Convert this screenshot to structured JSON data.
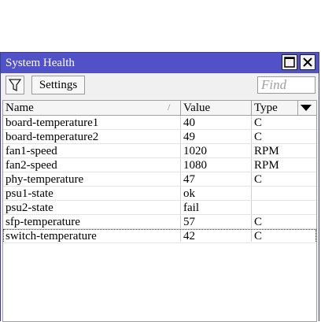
{
  "window": {
    "title": "System Health"
  },
  "toolbar": {
    "settings_label": "Settings",
    "find_placeholder": "Find"
  },
  "table": {
    "columns": [
      "Name",
      "Value",
      "Type"
    ],
    "sort_indicator": "/",
    "rows": [
      {
        "name": "board-temperature1",
        "value": "40",
        "type": "C"
      },
      {
        "name": "board-temperature2",
        "value": "49",
        "type": "C"
      },
      {
        "name": "fan1-speed",
        "value": "1020",
        "type": "RPM"
      },
      {
        "name": "fan2-speed",
        "value": "1080",
        "type": "RPM"
      },
      {
        "name": "phy-temperature",
        "value": "47",
        "type": "C"
      },
      {
        "name": "psu1-state",
        "value": "ok",
        "type": ""
      },
      {
        "name": "psu2-state",
        "value": "fail",
        "type": ""
      },
      {
        "name": "sfp-temperature",
        "value": "57",
        "type": "C"
      },
      {
        "name": "switch-temperature",
        "value": "42",
        "type": "C"
      }
    ],
    "selected_row": 8
  },
  "colors": {
    "titlebar": "#5252c8",
    "window_bg": "#f0f0f0"
  },
  "icons": {
    "filter": "filter-icon",
    "maximize": "maximize-icon",
    "close": "close-icon",
    "column_menu": "chevron-down-icon"
  }
}
